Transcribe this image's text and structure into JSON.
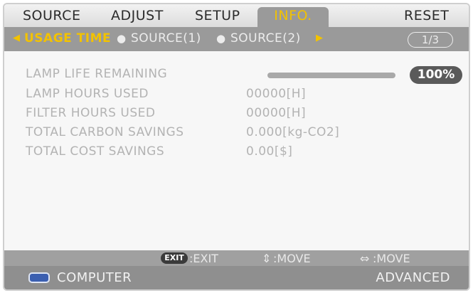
{
  "menu": {
    "tabs": [
      {
        "label": "SOURCE"
      },
      {
        "label": "ADJUST"
      },
      {
        "label": "SETUP"
      },
      {
        "label": "INFO."
      },
      {
        "label": "RESET"
      }
    ],
    "active_tab": "INFO."
  },
  "submenu": {
    "items": [
      {
        "label": "USAGE TIME"
      },
      {
        "label": "SOURCE(1)"
      },
      {
        "label": "SOURCE(2)"
      }
    ],
    "page": "1/3"
  },
  "info": {
    "lamp_life_label": "LAMP LIFE REMAINING",
    "lamp_life_percent": "100%",
    "lamp_life_fraction": 1.0,
    "rows": [
      {
        "label": "LAMP HOURS USED",
        "value": "00000[H]"
      },
      {
        "label": "FILTER HOURS USED",
        "value": "00000[H]"
      },
      {
        "label": "TOTAL CARBON SAVINGS",
        "value": "0.000[kg-CO2]"
      },
      {
        "label": "TOTAL COST SAVINGS",
        "value": "0.00[$]"
      }
    ]
  },
  "footer": {
    "exit_badge": "EXIT",
    "exit_label": ":EXIT",
    "move_label": ":MOVE",
    "move2_label": ":MOVE"
  },
  "status": {
    "source": "COMPUTER",
    "mode": "ADVANCED"
  },
  "colors": {
    "active_highlight": "#f2c200",
    "source_icon": "#3b5fb0"
  },
  "icons": [
    "left-arrow-icon",
    "right-arrow-icon",
    "up-down-arrow-icon",
    "left-right-arrow-icon",
    "computer-source-icon"
  ]
}
